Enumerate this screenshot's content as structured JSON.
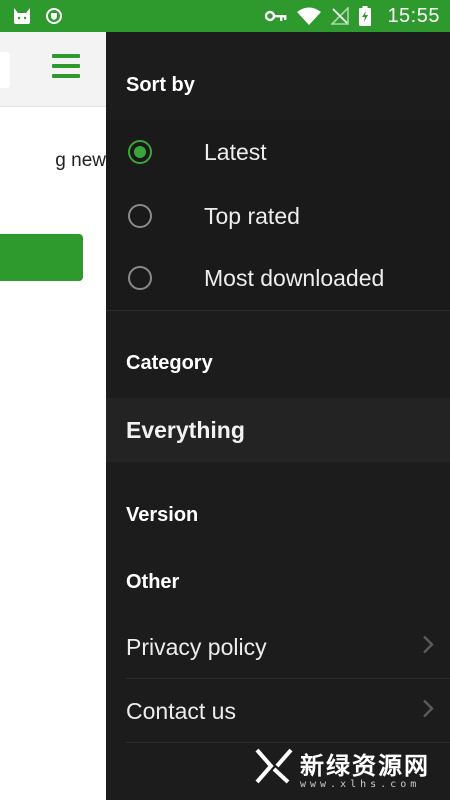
{
  "status_bar": {
    "time": "15:55",
    "icons": [
      "cat-icon",
      "shield-icon",
      "key-icon",
      "wifi-icon",
      "no-signal-icon",
      "battery-charging-icon"
    ]
  },
  "background_app": {
    "text_fragment": "g new"
  },
  "drawer": {
    "sort_by_header": "Sort by",
    "sort_options": [
      {
        "label": "Latest",
        "selected": true
      },
      {
        "label": "Top rated",
        "selected": false
      },
      {
        "label": "Most downloaded",
        "selected": false
      }
    ],
    "category_header": "Category",
    "category_value": "Everything",
    "version_header": "Version",
    "other_header": "Other",
    "links": [
      {
        "label": "Privacy policy"
      },
      {
        "label": "Contact us"
      }
    ]
  },
  "watermark": {
    "main": "新绿资源网",
    "sub": "www.xlhs.com"
  },
  "colors": {
    "accent": "#2e9a2e",
    "drawer_bg": "#1c1c1c",
    "radio_selected": "#3aa53a"
  }
}
